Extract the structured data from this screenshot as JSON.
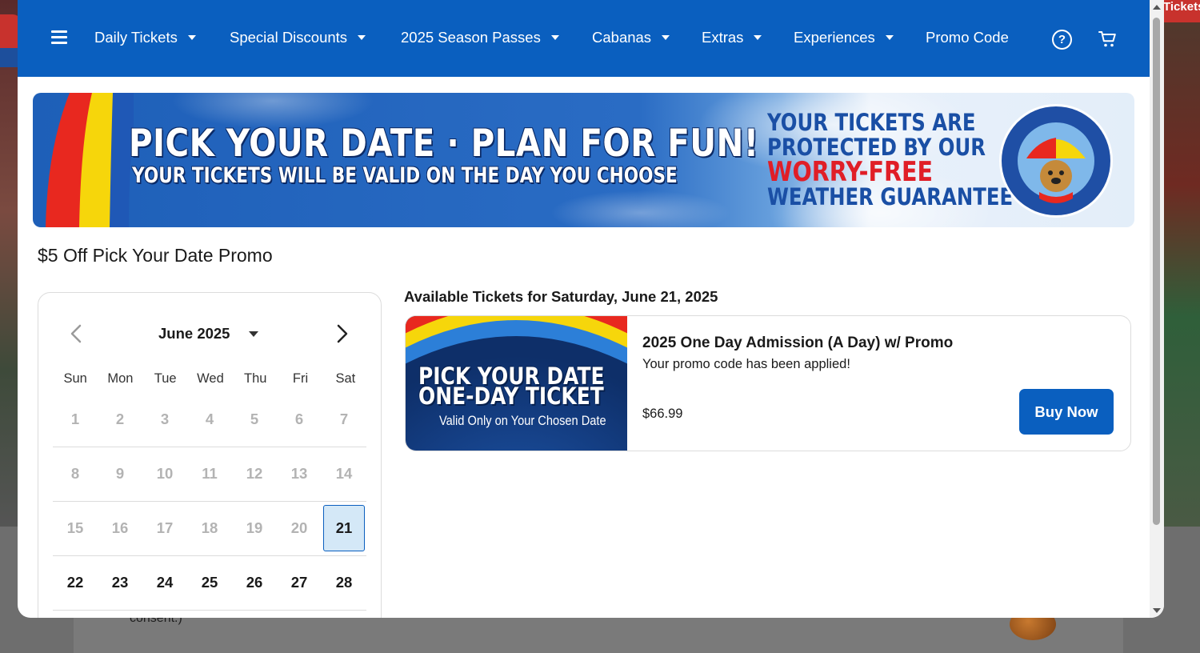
{
  "background": {
    "tickets_tab": "Tickets",
    "consent_text": "consent.)"
  },
  "nav": {
    "items": [
      {
        "label": "Daily Tickets",
        "has_dropdown": true
      },
      {
        "label": "Special Discounts",
        "has_dropdown": true
      },
      {
        "label": "2025 Season Passes",
        "has_dropdown": true
      },
      {
        "label": "Cabanas",
        "has_dropdown": true
      },
      {
        "label": "Extras",
        "has_dropdown": true
      },
      {
        "label": "Experiences",
        "has_dropdown": true
      },
      {
        "label": "Promo Code",
        "has_dropdown": false
      }
    ],
    "help_glyph": "?",
    "icons": [
      "menu-icon",
      "help-icon",
      "cart-icon"
    ],
    "color": "#0a5fbf"
  },
  "banner": {
    "title": "PICK YOUR DATE · PLAN FOR FUN!",
    "subtitle": "YOUR TICKETS WILL BE VALID ON THE DAY YOU CHOOSE",
    "guarantee_line1": "YOUR TICKETS ARE",
    "guarantee_line2": "PROTECTED BY OUR",
    "guarantee_line3": "WORRY-FREE",
    "guarantee_line4": "WEATHER GUARANTEE",
    "badge_text": "WORRY-FREE WEATHER GUARANTEE"
  },
  "promo": {
    "title": "$5 Off Pick Your Date Promo"
  },
  "calendar": {
    "month_label": "June 2025",
    "weekdays": [
      "Sun",
      "Mon",
      "Tue",
      "Wed",
      "Thu",
      "Fri",
      "Sat"
    ],
    "weeks": [
      [
        "1",
        "2",
        "3",
        "4",
        "5",
        "6",
        "7"
      ],
      [
        "8",
        "9",
        "10",
        "11",
        "12",
        "13",
        "14"
      ],
      [
        "15",
        "16",
        "17",
        "18",
        "19",
        "20",
        "21"
      ],
      [
        "22",
        "23",
        "24",
        "25",
        "26",
        "27",
        "28"
      ]
    ],
    "selected_day": "21",
    "first_available_day": 21
  },
  "tickets": {
    "heading": "Available Tickets for Saturday, June 21, 2025",
    "items": [
      {
        "image_line1": "PICK YOUR DATE",
        "image_line2": "ONE-DAY TICKET",
        "image_line3": "Valid Only on Your Chosen Date",
        "name": "2025 One Day Admission (A Day) w/ Promo",
        "note": "Your promo code has been applied!",
        "price": "$66.99",
        "button_label": "Buy Now"
      }
    ]
  }
}
